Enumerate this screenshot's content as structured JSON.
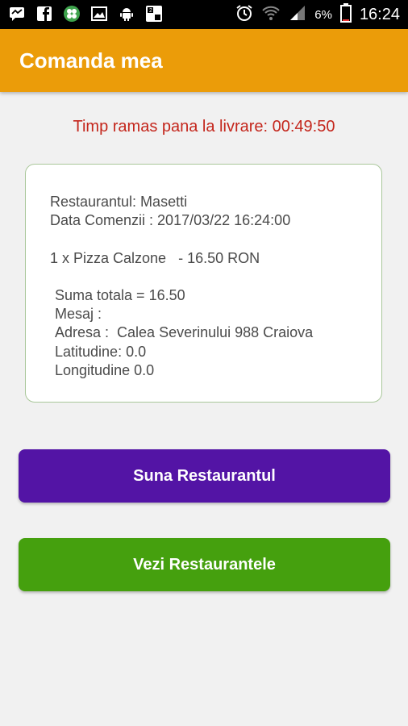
{
  "status_bar": {
    "battery_percent": "6%",
    "time": "16:24",
    "left_icons": [
      "message-icon",
      "facebook-icon",
      "clover-app-icon",
      "gallery-icon",
      "android-icon",
      "puzzle-app-icon"
    ],
    "right_icons": [
      "alarm-icon",
      "wifi-icon",
      "signal-icon",
      "battery-icon"
    ]
  },
  "app_bar": {
    "title": "Comanda mea",
    "color": "#eb9c09"
  },
  "timer_text": "Timp ramas pana la livrare: 00:49:50",
  "order": {
    "restaurant": "Restaurantul: Masetti",
    "date": "Data Comenzii : 2017/03/22 16:24:00",
    "item": "1 x Pizza Calzone   - 16.50 RON",
    "total": "Suma totala = 16.50",
    "message": "Mesaj :",
    "address": "Adresa :  Calea Severinului 988 Craiova",
    "latitude": "Latitudine: 0.0",
    "longitude": "Longitudine 0.0"
  },
  "buttons": {
    "call_label": "Suna Restaurantul",
    "call_color": "#5314a5",
    "list_label": "Vezi Restaurantele",
    "list_color": "#45a00e"
  }
}
